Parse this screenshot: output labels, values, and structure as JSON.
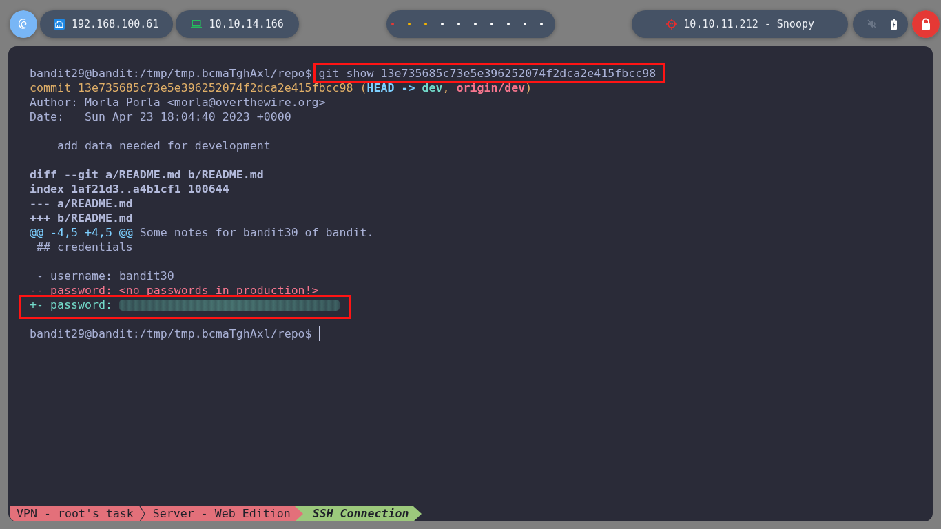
{
  "top_bar": {
    "local_ip": "192.168.100.61",
    "vpn_ip": "10.10.14.166",
    "workspaces": [
      {
        "color": "#e53935"
      },
      {
        "color": "#f4b400"
      },
      {
        "color": "#f4b400"
      },
      {
        "color": "#ffffff"
      },
      {
        "color": "#ffffff"
      },
      {
        "color": "#ffffff"
      },
      {
        "color": "#ffffff"
      },
      {
        "color": "#ffffff"
      },
      {
        "color": "#ffffff"
      },
      {
        "color": "#ffffff"
      }
    ],
    "target": "10.10.11.212 - Snoopy",
    "audio": {
      "muted": true
    }
  },
  "terminal": {
    "lines": [
      {
        "kind": "prompt",
        "prompt": "bandit29@bandit:/tmp/tmp.bcmaTghAxl/repo$",
        "command": "git show 13e735685c73e5e396252074f2dca2e415fbcc98",
        "highlighted": true,
        "cursor": false
      },
      {
        "kind": "output",
        "highlighted": false,
        "segments": [
          {
            "text": "commit 13e735685c73e5e396252074f2dca2e415fbcc98 (",
            "kind": "commit"
          },
          {
            "text": "HEAD -> ",
            "kind": "head"
          },
          {
            "text": "dev",
            "kind": "branch"
          },
          {
            "text": ", ",
            "kind": "commit"
          },
          {
            "text": "origin/dev",
            "kind": "remote"
          },
          {
            "text": ")",
            "kind": "commit"
          }
        ]
      },
      {
        "kind": "output",
        "highlighted": false,
        "segments": [
          {
            "text": "Author: Morla Porla <morla@overthewire.org>",
            "kind": "plain"
          }
        ]
      },
      {
        "kind": "output",
        "highlighted": false,
        "segments": [
          {
            "text": "Date:   Sun Apr 23 18:04:40 2023 +0000",
            "kind": "plain"
          }
        ]
      },
      {
        "kind": "blank"
      },
      {
        "kind": "output",
        "highlighted": false,
        "segments": [
          {
            "text": "add data needed for development",
            "kind": "message"
          }
        ]
      },
      {
        "kind": "blank"
      },
      {
        "kind": "output",
        "highlighted": false,
        "segments": [
          {
            "text": "diff --git a/README.md b/README.md",
            "kind": "header"
          }
        ]
      },
      {
        "kind": "output",
        "highlighted": false,
        "segments": [
          {
            "text": "index 1af21d3..a4b1cf1 100644",
            "kind": "header"
          }
        ]
      },
      {
        "kind": "output",
        "highlighted": false,
        "segments": [
          {
            "text": "--- a/README.md",
            "kind": "header"
          }
        ]
      },
      {
        "kind": "output",
        "highlighted": false,
        "segments": [
          {
            "text": "+++ b/README.md",
            "kind": "header"
          }
        ]
      },
      {
        "kind": "output",
        "highlighted": false,
        "segments": [
          {
            "text": "@@ -4,5 +4,5 @@",
            "kind": "hunk"
          },
          {
            "text": " Some notes for bandit30 of bandit.",
            "kind": "plain"
          }
        ]
      },
      {
        "kind": "output",
        "highlighted": false,
        "segments": [
          {
            "text": "## credentials",
            "kind": "context"
          }
        ]
      },
      {
        "kind": "blank"
      },
      {
        "kind": "output",
        "highlighted": false,
        "segments": [
          {
            "text": "- username: bandit30",
            "kind": "context"
          }
        ]
      },
      {
        "kind": "output",
        "highlighted": false,
        "segments": [
          {
            "text": "-- password: <no passwords in production!>",
            "kind": "removed"
          }
        ]
      },
      {
        "kind": "output",
        "highlighted": true,
        "segments": [
          {
            "text": "+- password:",
            "kind": "added"
          },
          {
            "kind": "redacted"
          }
        ]
      },
      {
        "kind": "blank"
      },
      {
        "kind": "prompt",
        "prompt": "bandit29@bandit:/tmp/tmp.bcmaTghAxl/repo$",
        "highlighted": false,
        "cursor": true
      }
    ]
  },
  "status_bar": {
    "tabs": [
      {
        "label": "VPN - root's task",
        "selected": false
      },
      {
        "label": "Server - Web Edition",
        "selected": false
      },
      {
        "label": "SSH Connection",
        "selected": true
      }
    ]
  }
}
